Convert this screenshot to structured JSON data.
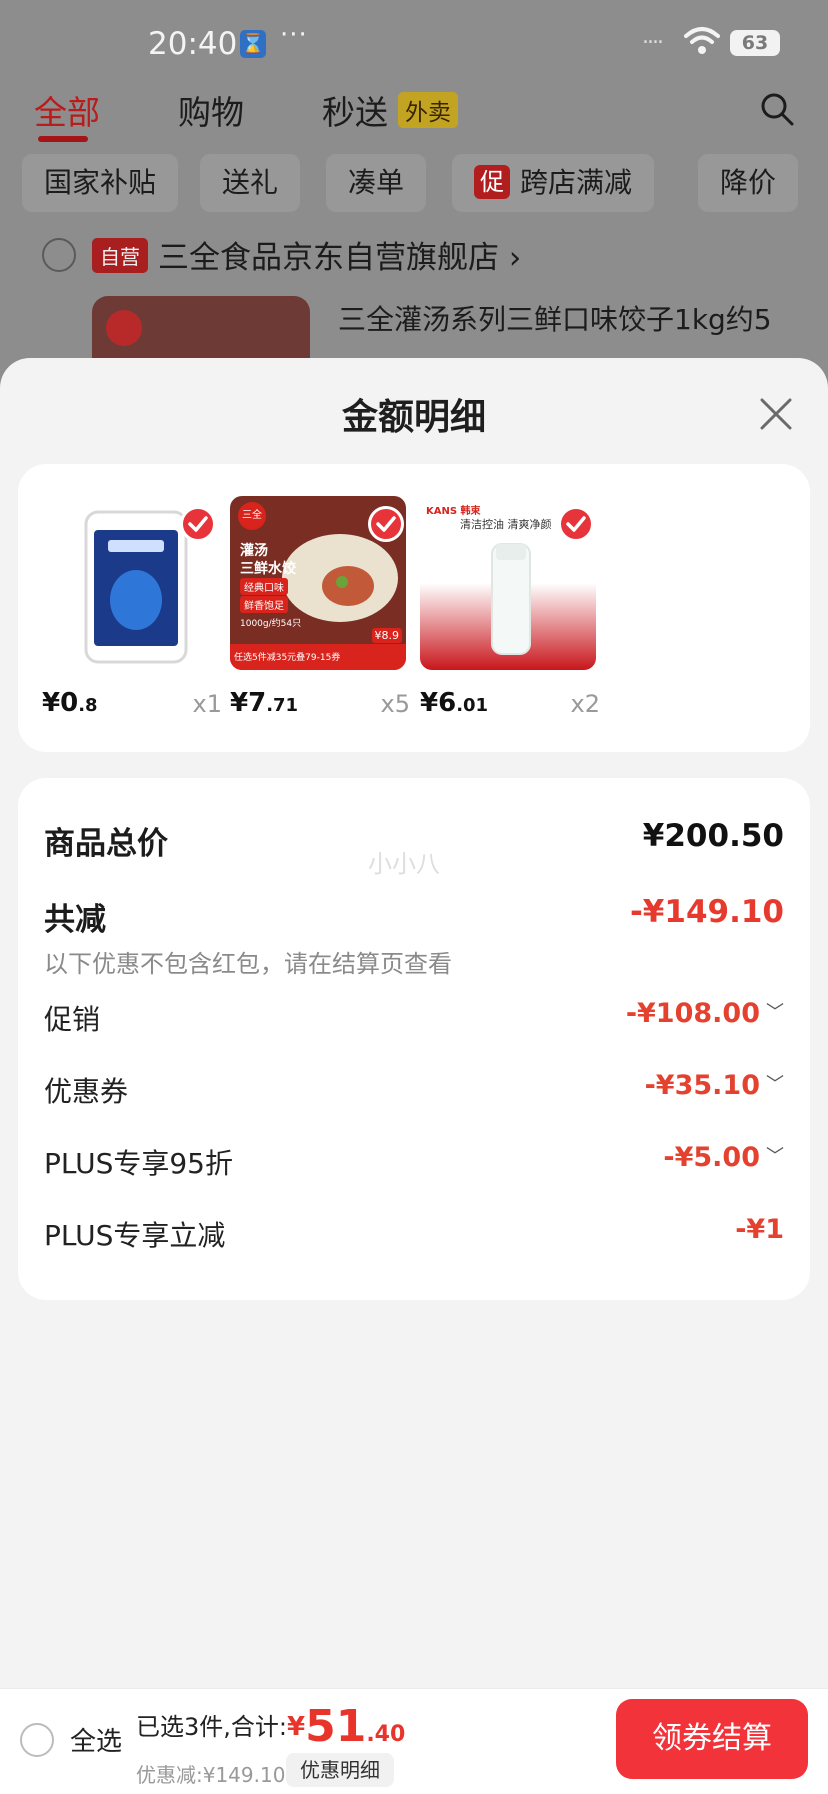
{
  "status_bar": {
    "time": "20:40",
    "hourglass": "⌛",
    "dots": "···",
    "signal": "....",
    "battery": "63"
  },
  "nav_tabs": [
    {
      "label": "全部",
      "active": true
    },
    {
      "label": "购物"
    },
    {
      "label": "秒送"
    }
  ],
  "waimai_badge": "外卖",
  "filter_chips": [
    {
      "label": "国家补贴"
    },
    {
      "label": "送礼"
    },
    {
      "label": "凑单"
    },
    {
      "label": "跨店满减",
      "promo_badge": "促"
    },
    {
      "label": "降价"
    }
  ],
  "store": {
    "tag": "自营",
    "name": "三全食品京东自营旗舰店 ›"
  },
  "background_product": {
    "title": "三全灌汤系列三鲜口味饺子1kg约5"
  },
  "sheet": {
    "title": "金额明细",
    "items": [
      {
        "price_yen": "¥",
        "price_int": "0",
        "price_dec": ".8",
        "qty": "x1"
      },
      {
        "price_yen": "¥",
        "price_int": "7",
        "price_dec": ".71",
        "qty": "x5",
        "image_text": {
          "brand": "三全",
          "line1": "灌汤",
          "line2": "三鲜水饺",
          "tag1": "经典口味",
          "tag2": "鲜香饱足",
          "spec": "1000g/约54只",
          "promo": "任选5件减35元叠79-15券",
          "price_tag": "¥8.9"
        }
      },
      {
        "price_yen": "¥",
        "price_int": "6",
        "price_dec": ".01",
        "qty": "x2",
        "image_text": {
          "brand": "KANS 韩束",
          "slogan": "清洁控油 清爽净颜"
        }
      }
    ],
    "total": {
      "label": "商品总价",
      "value": "¥200.50"
    },
    "reduction": {
      "label": "共减",
      "value": "-¥149.10",
      "note": "以下优惠不包含红包，请在结算页查看"
    },
    "lines": [
      {
        "label": "促销",
        "value": "-¥108.00",
        "expandable": true
      },
      {
        "label": "优惠券",
        "value": "-¥35.10",
        "expandable": true
      },
      {
        "label": "PLUS专享95折",
        "value": "-¥5.00",
        "expandable": true
      },
      {
        "label": "PLUS专享立减",
        "value": "-¥1",
        "expandable": false
      }
    ],
    "watermark": "小小八"
  },
  "bottom_bar": {
    "select_all": "全选",
    "selected_text": "已选3件,合计:",
    "total_yen": "¥",
    "total_int": "51",
    "total_dec": ".40",
    "saved_text": "优惠减:¥149.10",
    "detail_link": "优惠明细",
    "checkout": "领券结算"
  },
  "colors": {
    "accent_red": "#e63a2e",
    "checkout_red": "#f2333a",
    "tab_active": "#b81c1c"
  }
}
